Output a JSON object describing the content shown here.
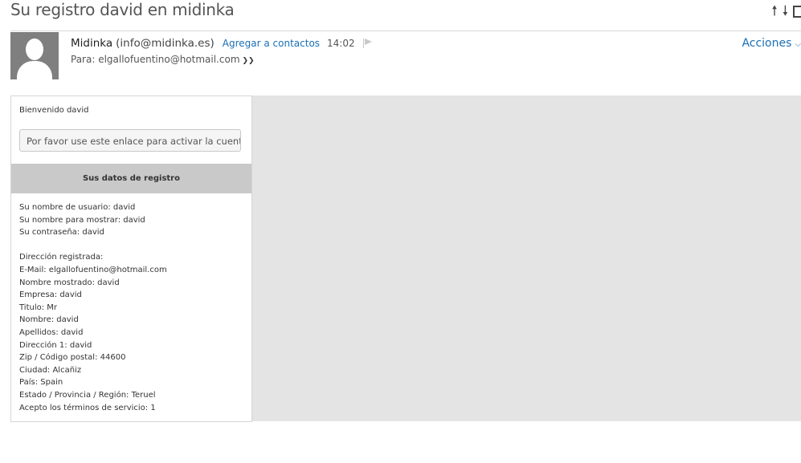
{
  "subject": "Su registro david en midinka",
  "sender": {
    "name": "Midinka",
    "email": "(info@midinka.es)",
    "add_contact": "Agregar a contactos",
    "time": "14:02"
  },
  "recipient": {
    "label": "Para: elgallofuentino@hotmail.com",
    "expand_icon": "double-chevron-down"
  },
  "actions_label": "Acciones",
  "body": {
    "welcome": "Bienvenido david",
    "activate_text": "Por favor use este enlace para activar la cuenta:",
    "section_title": "Sus datos de registro",
    "account_lines": [
      "Su nombre de usuario: david",
      "Su nombre para mostrar: david",
      "Su contraseña: david"
    ],
    "address_lines": [
      "Dirección registrada:",
      "E-Mail: elgallofuentino@hotmail.com",
      "Nombre mostrado: david",
      "Empresa: david",
      "Titulo: Mr",
      "Nombre: david",
      "Apellidos: david",
      "Dirección 1: david",
      "Zip / Código postal: 44600",
      "Ciudad: Alcañiz",
      "País: Spain",
      "Estado / Provincia / Región: Teruel",
      "Acepto los términos de servicio: 1"
    ]
  },
  "colors": {
    "link": "#1a6fb5",
    "avatar_bg": "#7f7f7f",
    "canvas_bg": "#e4e4e4",
    "section_bg": "#c9c9c9"
  }
}
